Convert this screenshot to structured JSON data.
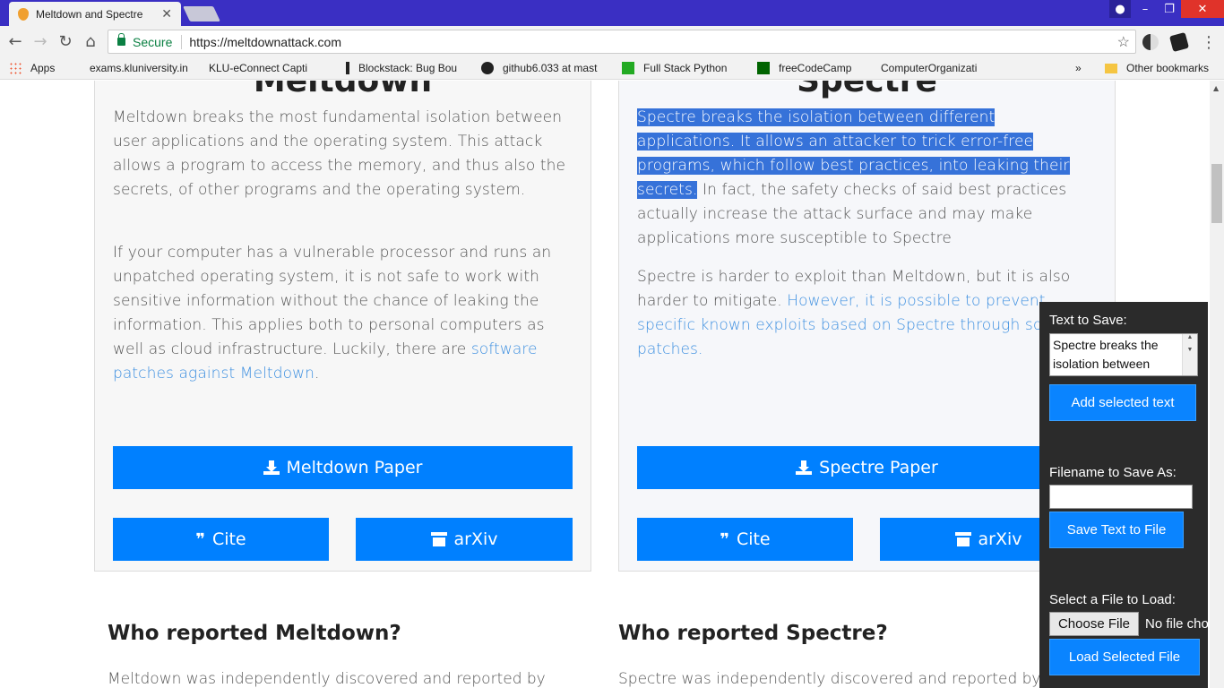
{
  "browser": {
    "tab_title": "Meltdown and Spectre",
    "secure_label": "Secure",
    "url": "https://meltdownattack.com",
    "bookmarks": [
      {
        "label": "Apps",
        "icon": "apps-grid-icon"
      },
      {
        "label": "exams.kluniversity.in",
        "icon": "page-icon"
      },
      {
        "label": "KLU-eConnect Capti",
        "icon": "page-icon"
      },
      {
        "label": "Blockstack: Bug Bou",
        "icon": "h-icon"
      },
      {
        "label": "github6.033 at mast",
        "icon": "github-icon"
      },
      {
        "label": "Full Stack Python",
        "icon": "fullstack-icon"
      },
      {
        "label": "freeCodeCamp",
        "icon": "fcc-icon"
      },
      {
        "label": "ComputerOrganizati",
        "icon": "page-icon"
      }
    ],
    "bookmarks_more": "»",
    "other_bookmarks": "Other bookmarks"
  },
  "meltdown": {
    "title": "Meltdown",
    "p1": "Meltdown breaks the most fundamental isolation between user applications and the operating system. This attack allows a program to access the memory, and thus also the secrets, of other programs and the operating system.",
    "p2_text": "If your computer has a vulnerable processor and runs an unpatched operating system, it is not safe to work with sensitive information without the chance of leaking the information. This applies both to personal computers as well as cloud infrastructure. Luckily, there are ",
    "p2_link": "software patches against Meltdown",
    "p2_end": ".",
    "paper_btn": "Meltdown Paper",
    "cite_btn": "Cite",
    "arxiv_btn": "arXiv"
  },
  "spectre": {
    "title": "Spectre",
    "p1_highlight": "Spectre breaks the isolation between different applications. It allows an attacker to trick error-free programs, which follow best practices, into leaking their secrets.",
    "p1_rest": " In fact, the safety checks of said best practices actually increase the attack surface and may make applications more susceptible to Spectre",
    "p2_text": "Spectre is harder to exploit than Meltdown, but it is also harder to mitigate. ",
    "p2_link": "However, it is possible to prevent specific known exploits based on Spectre through software patches.",
    "paper_btn": "Spectre Paper",
    "cite_btn": "Cite",
    "arxiv_btn": "arXiv"
  },
  "sections": {
    "meltdown_h": "Who reported Meltdown?",
    "meltdown_p": "Meltdown was independently discovered and reported by",
    "spectre_h": "Who reported Spectre?",
    "spectre_p": "Spectre was independently discovered and reported by"
  },
  "panel": {
    "text_label": "Text to Save:",
    "text_value": "Spectre breaks the isolation between",
    "add_btn": "Add selected text",
    "filename_label": "Filename to Save As:",
    "filename_value": "",
    "save_btn": "Save Text to File",
    "load_label": "Select a File to Load:",
    "choose_btn": "Choose File",
    "no_file": "No file chosen",
    "load_btn": "Load Selected File"
  },
  "colors": {
    "accent": "#0080ff",
    "link": "#3d8fe0",
    "highlight": "#3672d9",
    "titlebar": "#3a2fc3"
  }
}
